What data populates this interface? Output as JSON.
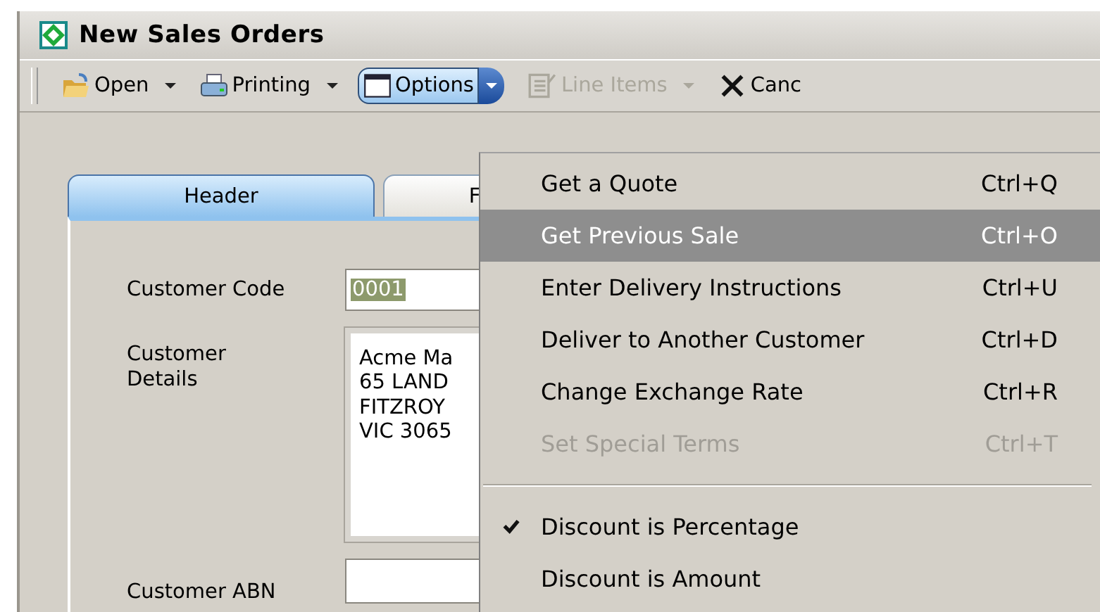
{
  "window": {
    "title": "New Sales Orders"
  },
  "toolbar": [
    {
      "kind": "split",
      "label": "Open",
      "disabled": false,
      "pressed": false
    },
    {
      "kind": "split",
      "label": "Printing",
      "disabled": false,
      "pressed": false
    },
    {
      "kind": "split",
      "label": "Options",
      "disabled": false,
      "pressed": true
    },
    {
      "kind": "split",
      "label": "Line Items",
      "disabled": true,
      "pressed": false
    },
    {
      "kind": "plain",
      "label": "Canc",
      "disabled": false,
      "pressed": false
    }
  ],
  "tabs": [
    {
      "label": "Header",
      "selected": true
    },
    {
      "label": "F",
      "selected": false
    }
  ],
  "form": {
    "customer_code": {
      "label": "Customer Code",
      "value": "0001",
      "selected_text": true
    },
    "customer_details": {
      "label": "Customer\nDetails",
      "lines": [
        "Acme Ma",
        "65 LAND",
        "FITZROY",
        "VIC 3065"
      ]
    },
    "customer_abn": {
      "label": "Customer ABN"
    }
  },
  "menu": [
    {
      "kind": "item",
      "label": "Get a Quote",
      "shortcut": "Ctrl+Q",
      "selected": false,
      "disabled": false,
      "checked": false
    },
    {
      "kind": "item",
      "label": "Get Previous Sale",
      "shortcut": "Ctrl+O",
      "selected": true,
      "disabled": false,
      "checked": false
    },
    {
      "kind": "item",
      "label": "Enter Delivery Instructions",
      "shortcut": "Ctrl+U",
      "selected": false,
      "disabled": false,
      "checked": false
    },
    {
      "kind": "item",
      "label": "Deliver to Another Customer",
      "shortcut": "Ctrl+D",
      "selected": false,
      "disabled": false,
      "checked": false
    },
    {
      "kind": "item",
      "label": "Change Exchange Rate",
      "shortcut": "Ctrl+R",
      "selected": false,
      "disabled": false,
      "checked": false
    },
    {
      "kind": "item",
      "label": "Set Special Terms",
      "shortcut": "Ctrl+T",
      "selected": false,
      "disabled": true,
      "checked": false
    },
    {
      "kind": "separator"
    },
    {
      "kind": "item",
      "label": "Discount is Percentage",
      "selected": false,
      "disabled": false,
      "checked": true
    },
    {
      "kind": "item",
      "label": "Discount is Amount",
      "selected": false,
      "disabled": false,
      "checked": false
    }
  ]
}
